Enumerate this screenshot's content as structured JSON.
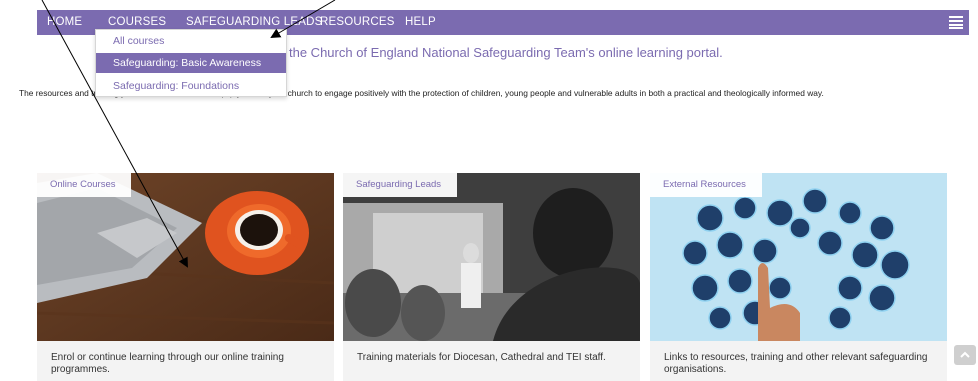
{
  "nav": {
    "items": [
      "HOME",
      "COURSES",
      "SAFEGUARDING LEADS",
      "RESOURCES",
      "HELP"
    ],
    "menu_icon": "hamburger-list-icon"
  },
  "dropdown": {
    "items": [
      "All courses",
      "Safeguarding: Basic Awareness",
      "Safeguarding: Foundations"
    ],
    "active_index": 1
  },
  "welcome_text": "the Church of England National Safeguarding Team's online learning portal.",
  "intro_text": "The resources and training you can access here will equip you and your church to engage positively with the protection of children, young people and vulnerable adults in both a practical and theologically informed way.",
  "cards": [
    {
      "tag": "Online Courses",
      "text": "Enrol or continue learning through our online training programmes.",
      "image": "laptop-and-coffee-photo"
    },
    {
      "tag": "Safeguarding Leads",
      "text": "Training materials for Diocesan, Cathedral and TEI staff.",
      "image": "lecture-audience-photo"
    },
    {
      "tag": "External Resources",
      "text": "Links to resources, training and other relevant safeguarding organisations.",
      "image": "app-icons-touch-photo"
    }
  ],
  "colors": {
    "brand": "#7b6bb0",
    "card_body": "#f3f3f3"
  },
  "scroll_top_icon": "chevron-up-icon"
}
